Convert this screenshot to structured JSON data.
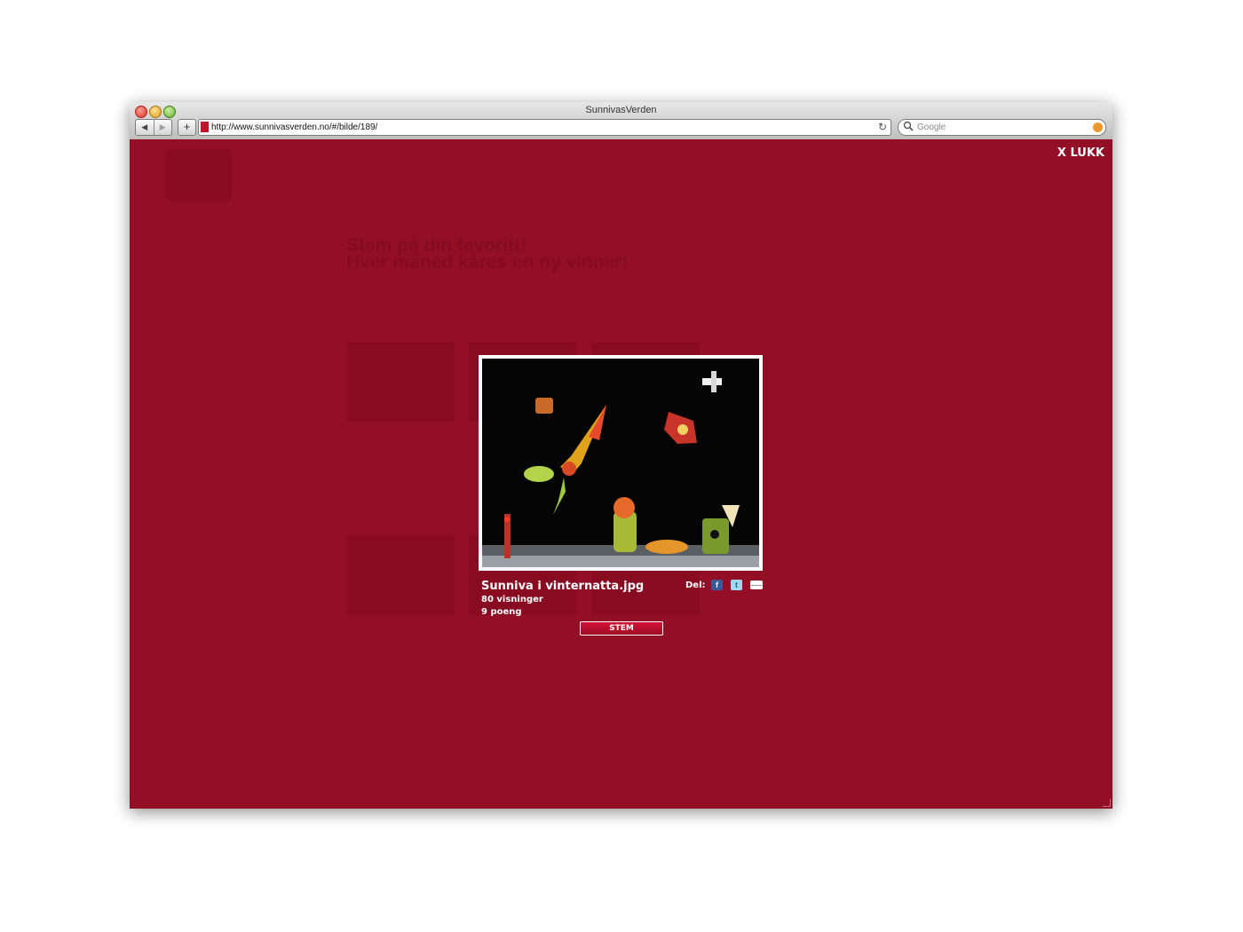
{
  "browser": {
    "window_title": "SunnivasVerden",
    "url": "http://www.sunnivasverden.no/#/bilde/189/",
    "search_placeholder": "Google",
    "back_glyph": "◀",
    "forward_glyph": "▶",
    "add_glyph": "+",
    "reload_glyph": "↻",
    "search_glyph": "🔍"
  },
  "page": {
    "background_color": "#920f26",
    "close_label": "X LUKK",
    "background_headline_1": "Stem på din favoritt!",
    "background_headline_2": "Hver måned kåres en ny vinner!"
  },
  "lightbox": {
    "photo_title": "Sunniva i vinternatta.jpg",
    "views": "80 visninger",
    "points": "9 poeng",
    "share_label": "Del:",
    "vote_label": "STEM",
    "facebook_glyph": "f",
    "twitter_glyph": "t",
    "accent_color": "#c4102b"
  }
}
